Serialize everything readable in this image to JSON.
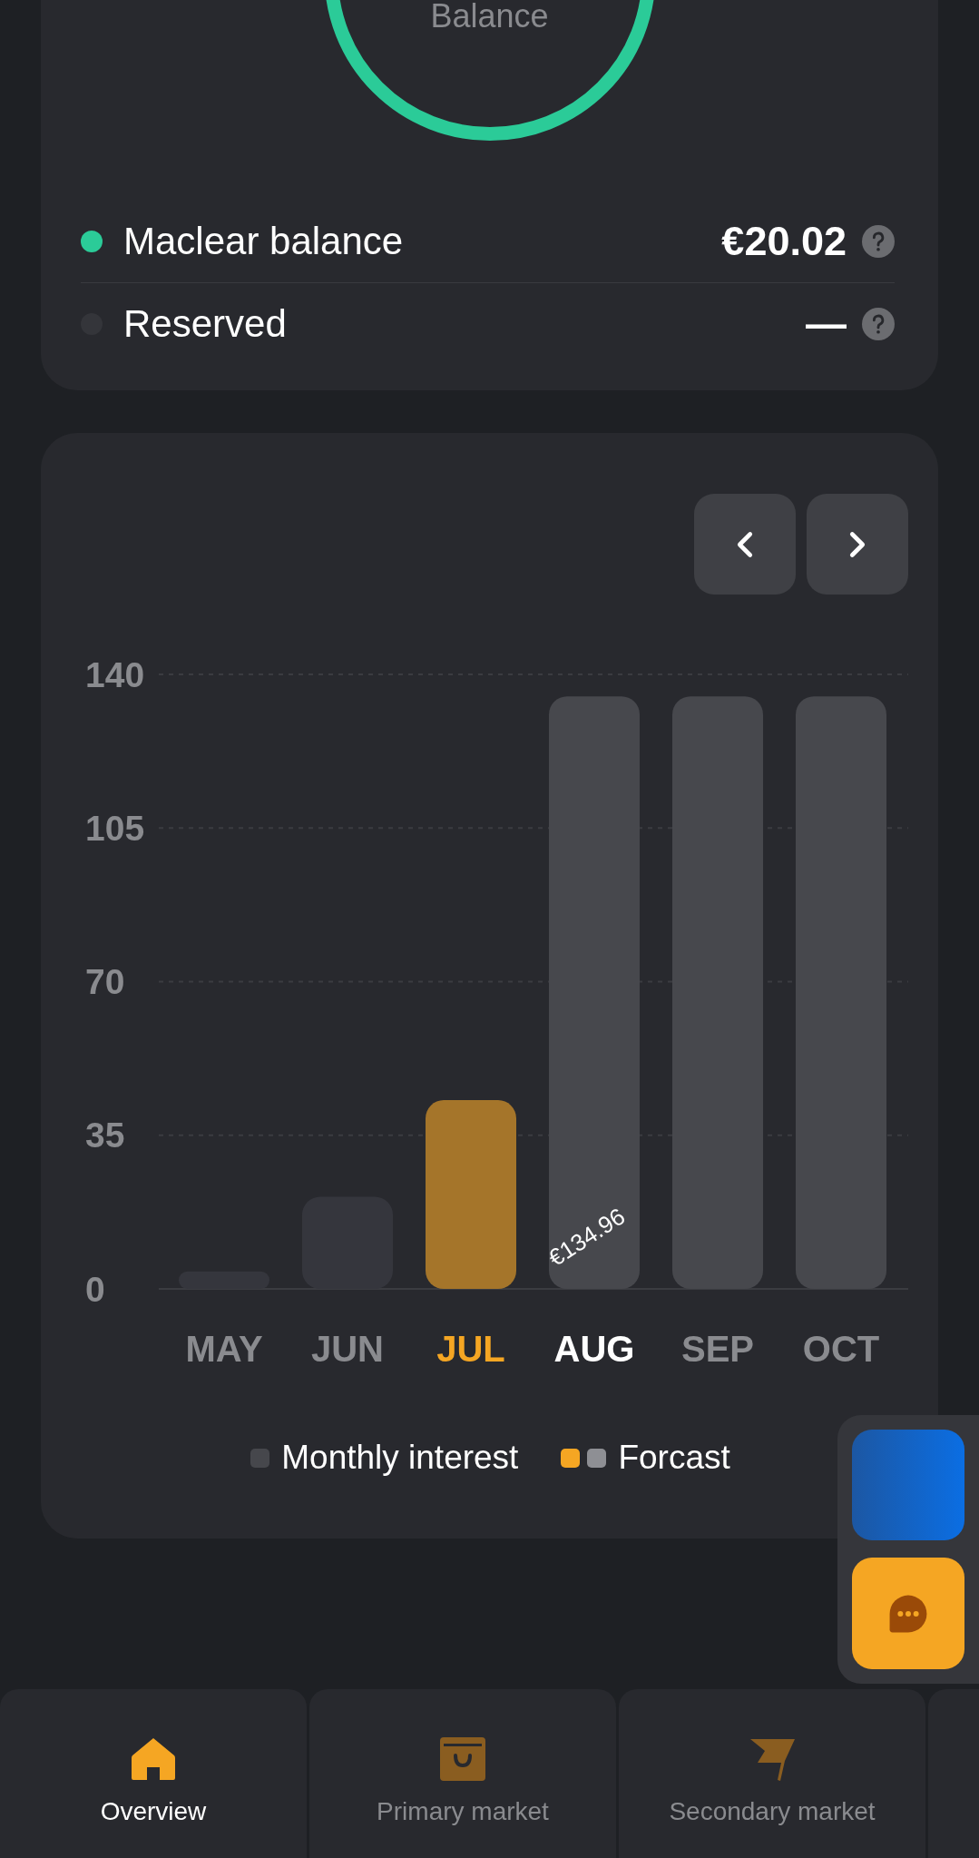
{
  "balance_card": {
    "ring_label": "Balance",
    "items": [
      {
        "label": "Maclear balance",
        "value": "€20.02",
        "color": "#2bcb98"
      },
      {
        "label": "Reserved",
        "value": "—",
        "color": "#34353a"
      }
    ]
  },
  "interest_chart": {
    "chart_data": {
      "type": "bar",
      "categories": [
        "MAY",
        "JUN",
        "JUL",
        "AUG",
        "SEP",
        "OCT"
      ],
      "series": [
        {
          "name": "Monthly interest",
          "color": "#35363d",
          "values": [
            4,
            21,
            null,
            null,
            null,
            null
          ]
        },
        {
          "name": "Forcast",
          "color": "#a5752a",
          "values": [
            null,
            null,
            43,
            null,
            null,
            null
          ]
        },
        {
          "color": "#47484d",
          "values": [
            null,
            null,
            null,
            135,
            135,
            135
          ]
        }
      ],
      "ylim": [
        0,
        140
      ],
      "yticks": [
        0,
        35,
        70,
        105,
        140
      ],
      "grid": true,
      "value_labels": [
        null,
        null,
        null,
        "€134.96",
        null,
        null
      ]
    },
    "month_states": [
      {
        "selected": false,
        "current": false
      },
      {
        "selected": false,
        "current": false
      },
      {
        "selected": true,
        "current": false
      },
      {
        "selected": false,
        "current": true
      },
      {
        "selected": false,
        "current": false
      },
      {
        "selected": false,
        "current": false
      }
    ],
    "legend": [
      {
        "swatches": [
          {
            "color": "#46474c"
          }
        ]
      },
      {
        "swatches": [
          {
            "color": "#f5a623"
          },
          {
            "color": "#8e8f94"
          }
        ]
      }
    ]
  },
  "nav_tabs": [
    {
      "label": "Overview",
      "kind": "home",
      "selected": true
    },
    {
      "label": "Primary market",
      "kind": "shop",
      "selected": false
    },
    {
      "label": "Secondary market",
      "kind": "flag",
      "selected": false
    }
  ]
}
